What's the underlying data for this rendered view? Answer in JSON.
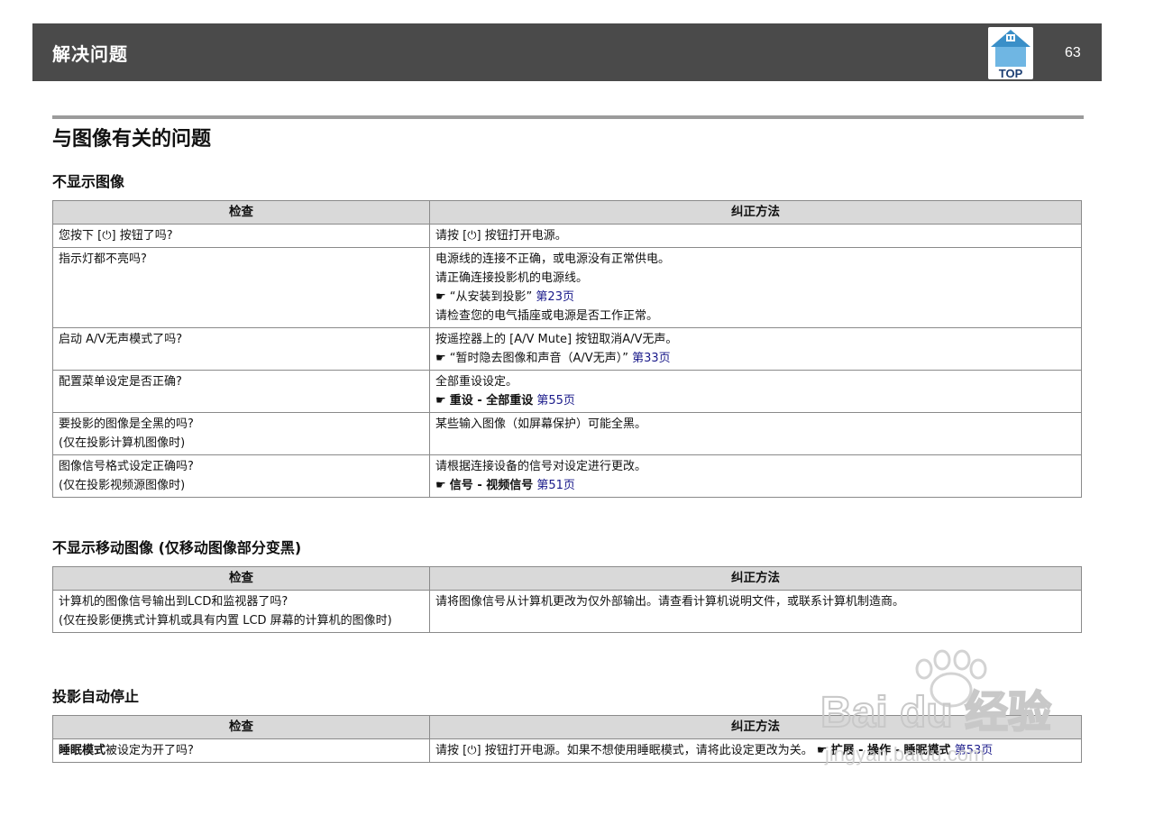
{
  "header": {
    "title": "解决问题",
    "page_number": "63",
    "top_icon_label": "TOP"
  },
  "h1": "与图像有关的问题",
  "sections": [
    {
      "title": "不显示图像",
      "col_check": "检查",
      "col_fix": "纠正方法",
      "rows": [
        {
          "check": [
            "您按下 [⏻] 按钮了吗?"
          ],
          "fix": [
            "请按 [⏻] 按钮打开电源。"
          ]
        },
        {
          "check": [
            "指示灯都不亮吗?"
          ],
          "fix_a": "电源线的连接不正确，或电源没有正常供电。",
          "fix_b": "请正确连接投影机的电源线。",
          "fix_ref_hand": "☛",
          "fix_ref_text": "“从安装到投影”",
          "fix_ref_link": "第23页",
          "fix_c": "请检查您的电气插座或电源是否工作正常。"
        },
        {
          "check": [
            "启动 A/V无声模式了吗?"
          ],
          "fix_a": "按遥控器上的 [A/V Mute] 按钮取消A/V无声。",
          "fix_ref_hand": "☛",
          "fix_ref_text": "“暂时隐去图像和声音（A/V无声）”",
          "fix_ref_link": "第33页"
        },
        {
          "check": [
            "配置菜单设定是否正确?"
          ],
          "fix_a": "全部重设设定。",
          "fix_ref_hand": "☛",
          "fix_ref_text": "重设 - 全部重设",
          "fix_ref_link": "第55页"
        },
        {
          "check": [
            "要投影的图像是全黑的吗?",
            "(仅在投影计算机图像时)"
          ],
          "fix_a": "某些输入图像（如屏幕保护）可能全黑。"
        },
        {
          "check": [
            "图像信号格式设定正确吗?",
            "(仅在投影视频源图像时)"
          ],
          "fix_a": "请根据连接设备的信号对设定进行更改。",
          "fix_ref_hand": "☛",
          "fix_ref_text": "信号 - 视频信号",
          "fix_ref_link": "第51页"
        }
      ]
    },
    {
      "title": "不显示移动图像 (仅移动图像部分变黑)",
      "col_check": "检查",
      "col_fix": "纠正方法",
      "rows": [
        {
          "check_a": "计算机的图像信号输出到LCD和监视器了吗?",
          "check_b": "(仅在投影便携式计算机或具有内置 LCD 屏幕的计算机的图像时)",
          "fix_a": "请将图像信号从计算机更改为仅外部输出。请查看计算机说明文件，或联系计算机制造商。"
        }
      ]
    },
    {
      "title": "投影自动停止",
      "col_check": "检查",
      "col_fix": "纠正方法",
      "rows": [
        {
          "check_bold": "睡眠模式",
          "check_rest": "被设定为开了吗?",
          "fix_a": "请按 [⏻] 按钮打开电源。如果不想使用睡眠模式，请将此设定更改为关。",
          "fix_ref_hand": "☛",
          "fix_ref_text": "扩展 - 操作 - 睡眠模式",
          "fix_ref_link": "第53页"
        }
      ]
    }
  ],
  "watermark": {
    "text": "Bai du 经验",
    "url": "jingyan.baidu.com"
  },
  "colors": {
    "header_bg": "#4a4a4a",
    "table_header_bg": "#d9d9d9",
    "link": "#1a1a8a",
    "top_icon_blue": "#3a8fc8"
  }
}
